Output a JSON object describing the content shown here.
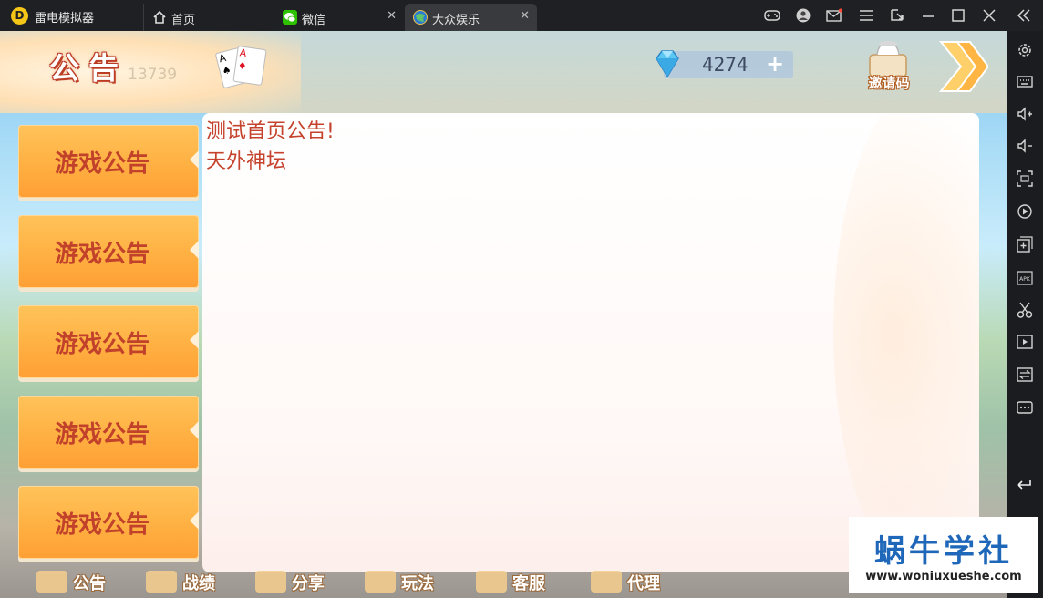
{
  "app": {
    "name": "雷电模拟器",
    "logo_letter": "D"
  },
  "tabs": [
    {
      "label": "首页",
      "icon": "home-icon"
    },
    {
      "label": "微信",
      "icon": "wechat-icon",
      "close": "✕"
    },
    {
      "label": "大众娱乐",
      "icon": "game-globe-icon",
      "close": "✕",
      "active": true
    }
  ],
  "titlebar_icons": [
    "gamepad-icon",
    "user-icon",
    "mail-icon",
    "menu-icon",
    "expand-icon",
    "minimize-icon",
    "maximize-icon",
    "close-icon",
    "collapse-icon"
  ],
  "sidebar_icons": [
    "settings-icon",
    "keyboard-icon",
    "volume-up-icon",
    "volume-down-icon",
    "screenshot-icon",
    "record-icon",
    "add-window-icon",
    "apk-icon",
    "scissors-icon",
    "video-icon",
    "sync-icon",
    "more-icon",
    "back-arrow-icon"
  ],
  "game": {
    "page_title": "公告",
    "bg_number": "13739",
    "diamonds": {
      "count": "4274",
      "plus": "+"
    },
    "invite_label": "邀请码",
    "menu_items": [
      {
        "label": "游戏公告"
      },
      {
        "label": "游戏公告"
      },
      {
        "label": "游戏公告"
      },
      {
        "label": "游戏公告"
      },
      {
        "label": "游戏公告"
      }
    ],
    "announcement_lines": [
      "测试首页公告!",
      "天外神坛"
    ],
    "bottom_nav": [
      {
        "label": "公告"
      },
      {
        "label": "战绩"
      },
      {
        "label": "分享"
      },
      {
        "label": "玩法"
      },
      {
        "label": "客服"
      },
      {
        "label": "代理"
      }
    ]
  },
  "watermark": {
    "title": "蜗牛学社",
    "url": "www.woniuxueshe.com"
  },
  "colors": {
    "accent_orange": "#ffb042",
    "text_red": "#c5432d",
    "titlebar": "#1f2023",
    "watermark_blue": "#1f67b9"
  }
}
